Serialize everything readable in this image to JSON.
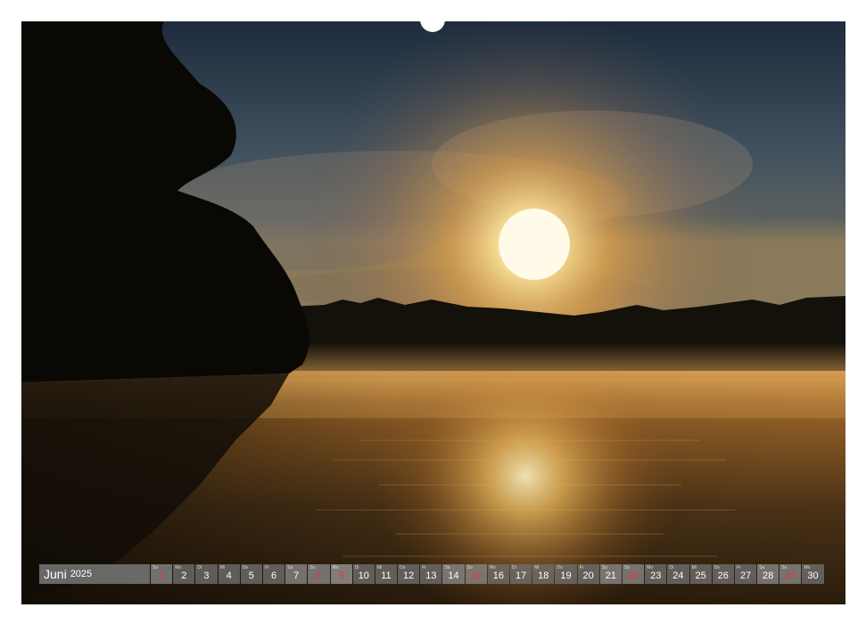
{
  "calendar": {
    "month": "Juni",
    "year": "2025",
    "days": [
      {
        "wd": "So",
        "num": "1",
        "type": "sunday"
      },
      {
        "wd": "Mo",
        "num": "2",
        "type": "weekday"
      },
      {
        "wd": "Di",
        "num": "3",
        "type": "weekday"
      },
      {
        "wd": "Mi",
        "num": "4",
        "type": "weekday"
      },
      {
        "wd": "Do",
        "num": "5",
        "type": "weekday"
      },
      {
        "wd": "Fr",
        "num": "6",
        "type": "weekday"
      },
      {
        "wd": "Sa",
        "num": "7",
        "type": "weekend"
      },
      {
        "wd": "So",
        "num": "8",
        "type": "sunday"
      },
      {
        "wd": "Mo",
        "num": "9",
        "type": "holiday"
      },
      {
        "wd": "Di",
        "num": "10",
        "type": "weekday"
      },
      {
        "wd": "Mi",
        "num": "11",
        "type": "weekday"
      },
      {
        "wd": "Do",
        "num": "12",
        "type": "weekday"
      },
      {
        "wd": "Fr",
        "num": "13",
        "type": "weekday"
      },
      {
        "wd": "Sa",
        "num": "14",
        "type": "weekend"
      },
      {
        "wd": "So",
        "num": "15",
        "type": "sunday"
      },
      {
        "wd": "Mo",
        "num": "16",
        "type": "weekday"
      },
      {
        "wd": "Di",
        "num": "17",
        "type": "weekday"
      },
      {
        "wd": "Mi",
        "num": "18",
        "type": "weekday"
      },
      {
        "wd": "Do",
        "num": "19",
        "type": "weekday"
      },
      {
        "wd": "Fr",
        "num": "20",
        "type": "weekday"
      },
      {
        "wd": "Sa",
        "num": "21",
        "type": "weekend"
      },
      {
        "wd": "So",
        "num": "22",
        "type": "sunday"
      },
      {
        "wd": "Mo",
        "num": "23",
        "type": "weekday"
      },
      {
        "wd": "Di",
        "num": "24",
        "type": "weekday"
      },
      {
        "wd": "Mi",
        "num": "25",
        "type": "weekday"
      },
      {
        "wd": "Do",
        "num": "26",
        "type": "weekday"
      },
      {
        "wd": "Fr",
        "num": "27",
        "type": "weekday"
      },
      {
        "wd": "Sa",
        "num": "28",
        "type": "weekend"
      },
      {
        "wd": "So",
        "num": "29",
        "type": "sunday"
      },
      {
        "wd": "Mo",
        "num": "30",
        "type": "weekday"
      }
    ]
  },
  "photo": {
    "subject": "sunrise-over-misty-lake",
    "colors": {
      "sky_top": "#243447",
      "sky_mid": "#51606a",
      "sun": "#fff6c8",
      "glow": "#f4b349",
      "mist": "#d19a4e",
      "water": "#3a2a16",
      "trees": "#0d0b07"
    }
  }
}
